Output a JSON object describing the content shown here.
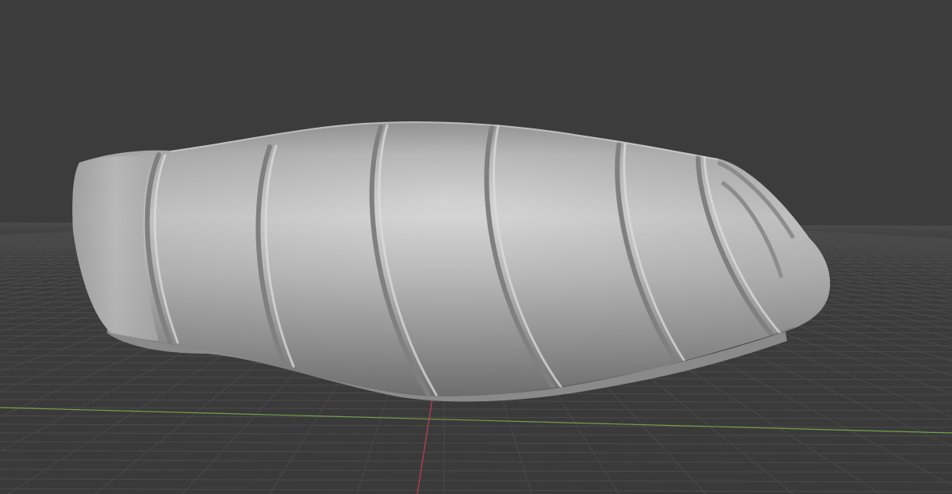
{
  "viewport": {
    "background_color": "#3d3d3d",
    "grid_color": "#4a4a4a",
    "x_axis_color": "#76a04a",
    "y_axis_color": "#c2404e"
  },
  "model": {
    "shading": "solid",
    "base_color": "#a3a3a3",
    "highlight_color": "#d2d2d2",
    "shadow_color": "#6a6a6a"
  }
}
